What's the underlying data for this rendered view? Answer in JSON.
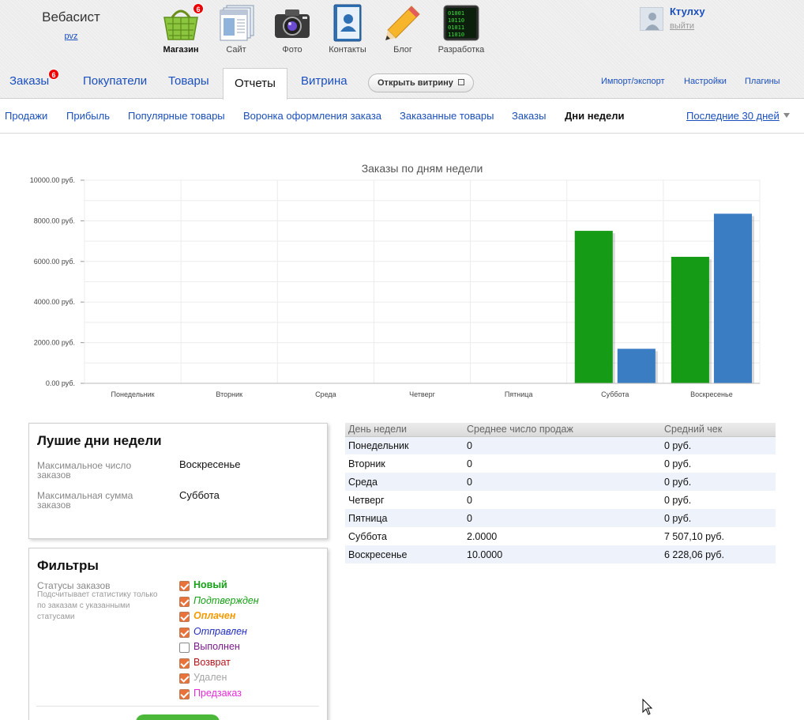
{
  "account": {
    "name": "Вебасист",
    "link": "pvz"
  },
  "apps": [
    {
      "label": "Магазин",
      "icon": "shop-basket-icon",
      "badge": "6",
      "active": true
    },
    {
      "label": "Сайт",
      "icon": "site-pages-icon"
    },
    {
      "label": "Фото",
      "icon": "camera-icon"
    },
    {
      "label": "Контакты",
      "icon": "contacts-book-icon"
    },
    {
      "label": "Блог",
      "icon": "pencil-icon"
    },
    {
      "label": "Разработка",
      "icon": "code-terminal-icon"
    }
  ],
  "user": {
    "name": "Ктулху",
    "logout": "выйти"
  },
  "mainnav": {
    "tabs": [
      {
        "label": "Заказы",
        "badge": "6"
      },
      {
        "label": "Покупатели"
      },
      {
        "label": "Товары"
      },
      {
        "label": "Отчеты",
        "active": true
      },
      {
        "label": "Витрина"
      }
    ],
    "open_storefront": "Открыть витрину",
    "links": [
      "Импорт/экспорт",
      "Настройки",
      "Плагины"
    ]
  },
  "subnav": {
    "tabs": [
      "Продажи",
      "Прибыль",
      "Популярные товары",
      "Воронка оформления заказа",
      "Заказанные товары",
      "Заказы",
      "Дни недели"
    ],
    "active": "Дни недели",
    "period": "Последние 30 дней"
  },
  "chart_data": {
    "type": "bar",
    "title": "Заказы по дням недели",
    "categories": [
      "Понедельник",
      "Вторник",
      "Среда",
      "Четверг",
      "Пятница",
      "Суббота",
      "Воскресенье"
    ],
    "series": [
      {
        "color": "#169b16",
        "values": [
          0,
          0,
          0,
          0,
          0,
          7507.1,
          6228.06
        ]
      },
      {
        "color": "#3a7dc2",
        "values": [
          0,
          0,
          0,
          0,
          0,
          1700,
          8350
        ]
      }
    ],
    "yticks": [
      "0.00 руб.",
      "2000.00 руб.",
      "4000.00 руб.",
      "6000.00 руб.",
      "8000.00 руб.",
      "10000.00 руб."
    ],
    "ylim": [
      0,
      10000
    ],
    "grid": true
  },
  "best_days": {
    "title": "Лушие дни недели",
    "max_orders_label": "Максимальное число заказов",
    "max_orders_value": "Воскресенье",
    "max_sum_label": "Максимальная сумма заказов",
    "max_sum_value": "Суббота"
  },
  "filters": {
    "title": "Фильтры",
    "statuses_label": "Статусы заказов",
    "statuses_hint": "Подсчитывает статистику только по заказам с указанными статусами",
    "statuses": [
      {
        "label": "Новый",
        "checked": true,
        "color": "#16a116",
        "bold": true,
        "italic": false
      },
      {
        "label": "Подтвержден",
        "checked": true,
        "color": "#16a116",
        "bold": false,
        "italic": true
      },
      {
        "label": "Оплачен",
        "checked": true,
        "color": "#f29a00",
        "bold": true,
        "italic": true
      },
      {
        "label": "Отправлен",
        "checked": true,
        "color": "#1f2bc4",
        "bold": false,
        "italic": true
      },
      {
        "label": "Выполнен",
        "checked": false,
        "color": "#7a1a8a",
        "bold": false,
        "italic": false
      },
      {
        "label": "Возврат",
        "checked": true,
        "color": "#b3141b",
        "bold": false,
        "italic": false
      },
      {
        "label": "Удален",
        "checked": true,
        "color": "#a5a5a5",
        "bold": false,
        "italic": false
      },
      {
        "label": "Предзаказ",
        "checked": true,
        "color": "#e62ad8",
        "bold": false,
        "italic": false
      }
    ]
  },
  "table": {
    "headers": [
      "День недели",
      "Среднее число продаж",
      "Средний чек"
    ],
    "rows": [
      [
        "Понедельник",
        "0",
        "0 руб."
      ],
      [
        "Вторник",
        "0",
        "0 руб."
      ],
      [
        "Среда",
        "0",
        "0 руб."
      ],
      [
        "Четверг",
        "0",
        "0 руб."
      ],
      [
        "Пятница",
        "0",
        "0 руб."
      ],
      [
        "Суббота",
        "2.0000",
        "7 507,10 руб."
      ],
      [
        "Воскресенье",
        "10.0000",
        "6 228,06 руб."
      ]
    ]
  }
}
